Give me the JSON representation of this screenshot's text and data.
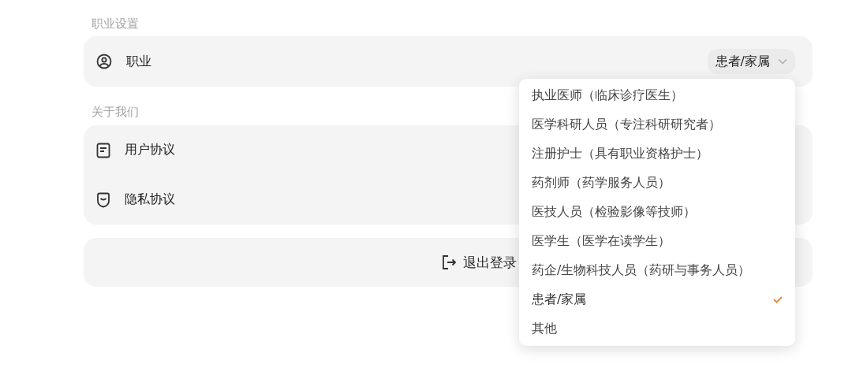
{
  "sections": [
    {
      "title": "职业设置",
      "rows": [
        {
          "kind": "select",
          "label": "职业",
          "value": "患者/家属"
        }
      ]
    },
    {
      "title": "关于我们",
      "rows": [
        {
          "kind": "link",
          "label": "用户协议"
        },
        {
          "kind": "link",
          "label": "隐私协议"
        }
      ]
    }
  ],
  "logout": {
    "label": "退出登录"
  },
  "dropdown": {
    "options": [
      {
        "label": "执业医师（临床诊疗医生）",
        "selected": false
      },
      {
        "label": "医学科研人员（专注科研研究者）",
        "selected": false
      },
      {
        "label": "注册护士（具有职业资格护士）",
        "selected": false
      },
      {
        "label": "药剂师（药学服务人员）",
        "selected": false
      },
      {
        "label": "医技人员（检验影像等技师）",
        "selected": false
      },
      {
        "label": "医学生（医学在读学生）",
        "selected": false
      },
      {
        "label": "药企/生物科技人员（药研与事务人员）",
        "selected": false
      },
      {
        "label": "患者/家属",
        "selected": true
      },
      {
        "label": "其他",
        "selected": false
      }
    ]
  }
}
